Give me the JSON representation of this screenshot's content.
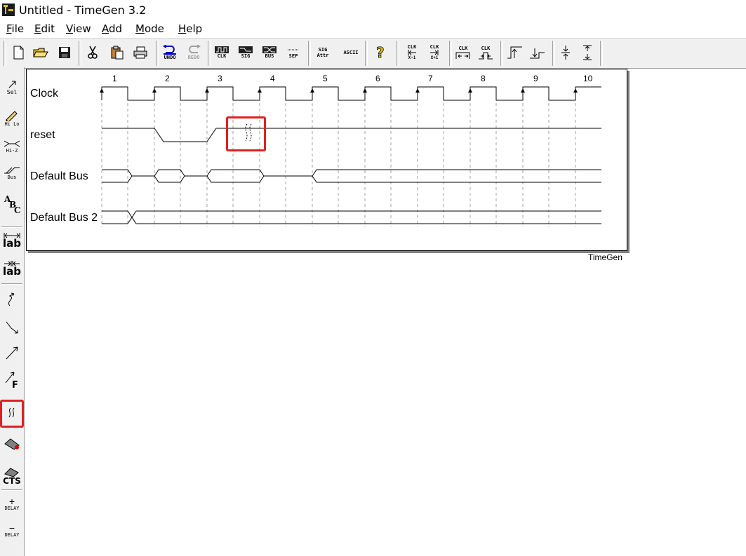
{
  "window": {
    "title": "Untitled - TimeGen 3.2"
  },
  "menu": [
    {
      "label": "File",
      "ul": "F",
      "rest": "ile"
    },
    {
      "label": "Edit",
      "ul": "E",
      "rest": "dit"
    },
    {
      "label": "View",
      "ul": "V",
      "rest": "iew"
    },
    {
      "label": "Add",
      "ul": "A",
      "rest": "dd"
    },
    {
      "label": "Mode",
      "ul": "M",
      "rest": "ode"
    },
    {
      "label": "Help",
      "ul": "H",
      "rest": "elp"
    }
  ],
  "toolbar": {
    "undo": "UNDO",
    "redo": "REDO",
    "clk": "CLK",
    "sig": "SIG",
    "bus": "BUS",
    "sep": "SEP",
    "sig_attr_1": "SIG",
    "sig_attr_2": "Attr",
    "ascii": "ASCII",
    "clk_left_top": "CLK",
    "clk_left_bottom": "X-1",
    "clk_right_top": "CLK",
    "clk_right_bottom": "X+1",
    "clk_a": "CLK",
    "clk_b": "CLK"
  },
  "palette": {
    "sel": "Sel",
    "hilo": "Hi Lo",
    "hiz": "Hi-Z",
    "bus": "Bus",
    "lab1": "lab",
    "lab2": "lab",
    "cts": "CTS",
    "delay_add": "DELAY",
    "delay_sub": "DELAY"
  },
  "diagram": {
    "signals": [
      "Clock",
      "reset",
      "Default Bus",
      "Default Bus 2"
    ],
    "cycles": [
      "1",
      "2",
      "3",
      "4",
      "5",
      "6",
      "7",
      "8",
      "9",
      "10"
    ],
    "brand": "TimeGen"
  },
  "colors": {
    "highlight": "#e02020",
    "background": "#ffffff",
    "toolbar": "#f0f0f0"
  }
}
